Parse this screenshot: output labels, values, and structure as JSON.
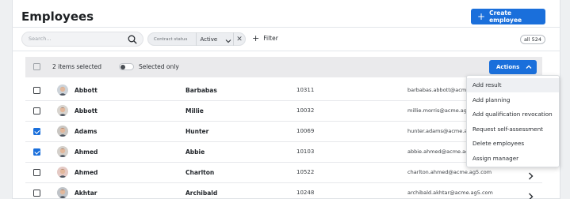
{
  "header": {
    "title": "Employees",
    "create_button": "Create employee"
  },
  "filters": {
    "search_placeholder": "Search...",
    "chip_label": "Contract status",
    "chip_value": "Active",
    "filter_label": "Filter",
    "count_label": "all 524"
  },
  "selection": {
    "selected_text": "2 items selected",
    "selected_only_label": "Selected only",
    "actions_label": "Actions"
  },
  "rows": [
    {
      "last": "Abbott",
      "first": "Barbabas",
      "id": "10311",
      "email": "barbabas.abbott@acme.ag5.com",
      "checked": false,
      "avatar_hair": "#b7a48a",
      "avatar_bg": "#cdd3d9"
    },
    {
      "last": "Abbott",
      "first": "Millie",
      "id": "10032",
      "email": "millie.morris@acme.ag5.com",
      "checked": false,
      "avatar_hair": "#2b2220",
      "avatar_bg": "#d8d4cf"
    },
    {
      "last": "Adams",
      "first": "Hunter",
      "id": "10069",
      "email": "hunter.adams@acme.ag5.com",
      "checked": true,
      "avatar_hair": "#5a3b2a",
      "avatar_bg": "#c9c6c2"
    },
    {
      "last": "Ahmed",
      "first": "Abbie",
      "id": "10103",
      "email": "abbie.ahmed@acme.ag5.com",
      "checked": true,
      "avatar_hair": "#3a2a22",
      "avatar_bg": "#d4d0cb"
    },
    {
      "last": "Ahmed",
      "first": "Charlton",
      "id": "10522",
      "email": "charlton.ahmed@acme.ag5.com",
      "checked": false,
      "avatar_hair": "#6e4a38",
      "avatar_bg": "#e4c9c4"
    },
    {
      "last": "Akhtar",
      "first": "Archibald",
      "id": "10248",
      "email": "archibald.akhtar@acme.ag5.com",
      "checked": false,
      "avatar_hair": "#1f1b1a",
      "avatar_bg": "#bfc3c8"
    }
  ],
  "actions_menu": [
    "Add result",
    "Add planning",
    "Add qualification revocation",
    "Request self-assessment",
    "Delete employees",
    "Assign manager"
  ],
  "colors": {
    "accent": "#1a6fdb",
    "selection_bar": "#eaeaec"
  }
}
